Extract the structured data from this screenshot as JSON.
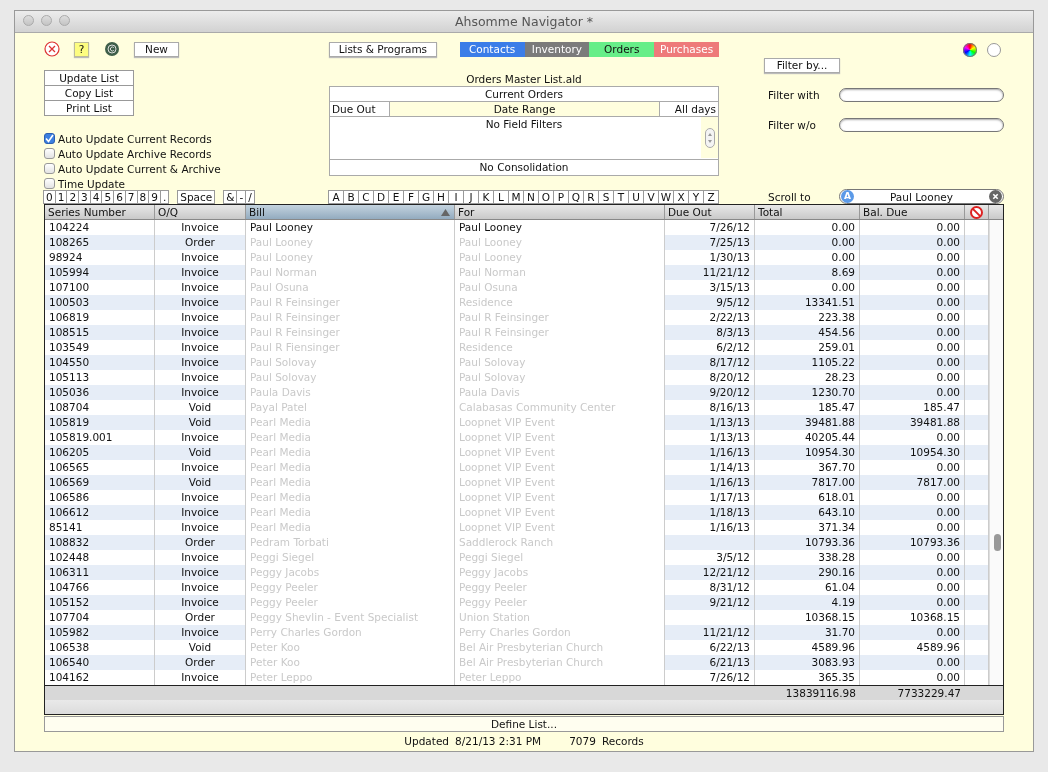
{
  "window": {
    "title": "Ahsomme Navigator *"
  },
  "toolbar": {
    "new_button": "New",
    "help_button": "?",
    "lists_button": "Lists & Programs",
    "filter_by_button": "Filter by..."
  },
  "tabs": [
    {
      "label": "Contacts",
      "color": "#3b7de8"
    },
    {
      "label": "Inventory",
      "color": "#7b7b7b"
    },
    {
      "label": "Orders",
      "color": "#66ee88"
    },
    {
      "label": "Purchases",
      "color": "#ee7a7a"
    }
  ],
  "list_buttons": [
    "Update List",
    "Copy List",
    "Print List"
  ],
  "checks": [
    {
      "label": "Auto Update Current Records",
      "checked": true
    },
    {
      "label": "Auto Update Archive Records",
      "checked": false
    },
    {
      "label": "Auto Update Current & Archive",
      "checked": false
    },
    {
      "label": "Time Update",
      "checked": false
    }
  ],
  "list_panel": {
    "file": "Orders Master List.ald",
    "selection": "Current Orders",
    "date_field": "Due Out",
    "date_label": "Date Range",
    "date_value": "All days",
    "filters": "No Field Filters",
    "consolidation": "No Consolidation"
  },
  "filters": {
    "with_label": "Filter with",
    "without_label": "Filter w/o",
    "scroll_label": "Scroll to",
    "scroll_value": "Paul Looney",
    "scroll_mode": "A"
  },
  "keys": [
    [
      "0",
      "1",
      "2",
      "3",
      "4",
      "5",
      "6",
      "7",
      "8",
      "9",
      "."
    ],
    [
      "Space"
    ],
    [
      "&",
      "-",
      "/"
    ],
    [
      "A",
      "B",
      "C",
      "D",
      "E",
      "F",
      "G",
      "H",
      "I",
      "J",
      "K",
      "L",
      "M",
      "N",
      "O",
      "P",
      "Q",
      "R",
      "S",
      "T",
      "U",
      "V",
      "W",
      "X",
      "Y",
      "Z"
    ]
  ],
  "table": {
    "columns": [
      {
        "label": "Series Number",
        "sorted": false
      },
      {
        "label": "O/Q",
        "sorted": false
      },
      {
        "label": "Bill",
        "sorted": true
      },
      {
        "label": "For",
        "sorted": false
      },
      {
        "label": "Due Out",
        "sorted": false
      },
      {
        "label": "Total",
        "sorted": false
      },
      {
        "label": "Bal. Due",
        "sorted": false
      }
    ],
    "rows": [
      {
        "series": "104224",
        "oq": "Invoice",
        "bill": "Paul Looney",
        "for": "Paul Looney",
        "due_out": "7/26/12",
        "total": "0.00",
        "balance": "0.00",
        "dimmed": false
      },
      {
        "series": "108265",
        "oq": "Order",
        "bill": "Paul Looney",
        "for": "Paul Looney",
        "due_out": "7/25/13",
        "total": "0.00",
        "balance": "0.00",
        "dimmed": true
      },
      {
        "series": "98924",
        "oq": "Invoice",
        "bill": "Paul Looney",
        "for": "Paul Looney",
        "due_out": "1/30/13",
        "total": "0.00",
        "balance": "0.00",
        "dimmed": true
      },
      {
        "series": "105994",
        "oq": "Invoice",
        "bill": "Paul Norman",
        "for": "Paul Norman",
        "due_out": "11/21/12",
        "total": "8.69",
        "balance": "0.00",
        "dimmed": true
      },
      {
        "series": "107100",
        "oq": "Invoice",
        "bill": "Paul Osuna",
        "for": "Paul Osuna",
        "due_out": "3/15/13",
        "total": "0.00",
        "balance": "0.00",
        "dimmed": true
      },
      {
        "series": "100503",
        "oq": "Invoice",
        "bill": "Paul R Feinsinger",
        "for": "Residence",
        "due_out": "9/5/12",
        "total": "13341.51",
        "balance": "0.00",
        "dimmed": true
      },
      {
        "series": "106819",
        "oq": "Invoice",
        "bill": "Paul R Feinsinger",
        "for": "Paul R Feinsinger",
        "due_out": "2/22/13",
        "total": "223.38",
        "balance": "0.00",
        "dimmed": true
      },
      {
        "series": "108515",
        "oq": "Invoice",
        "bill": "Paul R Feinsinger",
        "for": "Paul R Feinsinger",
        "due_out": "8/3/13",
        "total": "454.56",
        "balance": "0.00",
        "dimmed": true
      },
      {
        "series": "103549",
        "oq": "Invoice",
        "bill": "Paul R Fiensinger",
        "for": "Residence",
        "due_out": "6/2/12",
        "total": "259.01",
        "balance": "0.00",
        "dimmed": true
      },
      {
        "series": "104550",
        "oq": "Invoice",
        "bill": "Paul Solovay",
        "for": "Paul Solovay",
        "due_out": "8/17/12",
        "total": "1105.22",
        "balance": "0.00",
        "dimmed": true
      },
      {
        "series": "105113",
        "oq": "Invoice",
        "bill": "Paul Solovay",
        "for": "Paul Solovay",
        "due_out": "8/20/12",
        "total": "28.23",
        "balance": "0.00",
        "dimmed": true
      },
      {
        "series": "105036",
        "oq": "Invoice",
        "bill": "Paula Davis",
        "for": "Paula Davis",
        "due_out": "9/20/12",
        "total": "1230.70",
        "balance": "0.00",
        "dimmed": true
      },
      {
        "series": "108704",
        "oq": "Void",
        "bill": "Payal Patel",
        "for": "Calabasas Community Center",
        "due_out": "8/16/13",
        "total": "185.47",
        "balance": "185.47",
        "dimmed": true
      },
      {
        "series": "105819",
        "oq": "Void",
        "bill": "Pearl Media",
        "for": "Loopnet VIP Event",
        "due_out": "1/13/13",
        "total": "39481.88",
        "balance": "39481.88",
        "dimmed": true
      },
      {
        "series": "105819.001",
        "oq": "Invoice",
        "bill": "Pearl Media",
        "for": "Loopnet VIP Event",
        "due_out": "1/13/13",
        "total": "40205.44",
        "balance": "0.00",
        "dimmed": true
      },
      {
        "series": "106205",
        "oq": "Void",
        "bill": "Pearl Media",
        "for": "Loopnet VIP Event",
        "due_out": "1/16/13",
        "total": "10954.30",
        "balance": "10954.30",
        "dimmed": true
      },
      {
        "series": "106565",
        "oq": "Invoice",
        "bill": "Pearl Media",
        "for": "Loopnet VIP Event",
        "due_out": "1/14/13",
        "total": "367.70",
        "balance": "0.00",
        "dimmed": true
      },
      {
        "series": "106569",
        "oq": "Void",
        "bill": "Pearl Media",
        "for": "Loopnet VIP Event",
        "due_out": "1/16/13",
        "total": "7817.00",
        "balance": "7817.00",
        "dimmed": true
      },
      {
        "series": "106586",
        "oq": "Invoice",
        "bill": "Pearl Media",
        "for": "Loopnet VIP Event",
        "due_out": "1/17/13",
        "total": "618.01",
        "balance": "0.00",
        "dimmed": true
      },
      {
        "series": "106612",
        "oq": "Invoice",
        "bill": "Pearl Media",
        "for": "Loopnet VIP Event",
        "due_out": "1/18/13",
        "total": "643.10",
        "balance": "0.00",
        "dimmed": true
      },
      {
        "series": "85141",
        "oq": "Invoice",
        "bill": "Pearl Media",
        "for": "Loopnet VIP Event",
        "due_out": "1/16/13",
        "total": "371.34",
        "balance": "0.00",
        "dimmed": true
      },
      {
        "series": "108832",
        "oq": "Order",
        "bill": "Pedram Torbati",
        "for": "Saddlerock Ranch",
        "total": "10793.36",
        "balance": "10793.36",
        "dimmed": true
      },
      {
        "series": "102448",
        "oq": "Invoice",
        "bill": "Peggi Siegel",
        "for": "Peggi Siegel",
        "due_out": "3/5/12",
        "total": "338.28",
        "balance": "0.00",
        "dimmed": true
      },
      {
        "series": "106311",
        "oq": "Invoice",
        "bill": "Peggy Jacobs",
        "for": "Peggy Jacobs",
        "due_out": "12/21/12",
        "total": "290.16",
        "balance": "0.00",
        "dimmed": true
      },
      {
        "series": "104766",
        "oq": "Invoice",
        "bill": "Peggy Peeler",
        "for": "Peggy Peeler",
        "due_out": "8/31/12",
        "total": "61.04",
        "balance": "0.00",
        "dimmed": true
      },
      {
        "series": "105152",
        "oq": "Invoice",
        "bill": "Peggy Peeler",
        "for": "Peggy Peeler",
        "due_out": "9/21/12",
        "total": "4.19",
        "balance": "0.00",
        "dimmed": true
      },
      {
        "series": "107704",
        "oq": "Order",
        "bill": "Peggy Shevlin - Event Specialist",
        "for": "Union Station",
        "total": "10368.15",
        "balance": "10368.15",
        "dimmed": true
      },
      {
        "series": "105982",
        "oq": "Invoice",
        "bill": "Perry Charles Gordon",
        "for": "Perry Charles Gordon",
        "due_out": "11/21/12",
        "total": "31.70",
        "balance": "0.00",
        "dimmed": true
      },
      {
        "series": "106538",
        "oq": "Void",
        "bill": "Peter Koo",
        "for": "Bel Air Presbyterian Church",
        "due_out": "6/22/13",
        "total": "4589.96",
        "balance": "4589.96",
        "dimmed": true
      },
      {
        "series": "106540",
        "oq": "Order",
        "bill": "Peter Koo",
        "for": "Bel Air Presbyterian Church",
        "due_out": "6/21/13",
        "total": "3083.93",
        "balance": "0.00",
        "dimmed": true
      },
      {
        "series": "104162",
        "oq": "Invoice",
        "bill": "Peter Leppo",
        "for": "Peter Leppo",
        "due_out": "7/26/12",
        "total": "365.35",
        "balance": "0.00",
        "dimmed": true
      }
    ],
    "totals": {
      "total": "13839116.98",
      "balance": "7733229.47"
    }
  },
  "define_button": "Define List...",
  "status_bar": {
    "updated_label": "Updated",
    "updated_value": "8/21/13 2:31 PM",
    "count": "7079",
    "count_label": "Records"
  }
}
